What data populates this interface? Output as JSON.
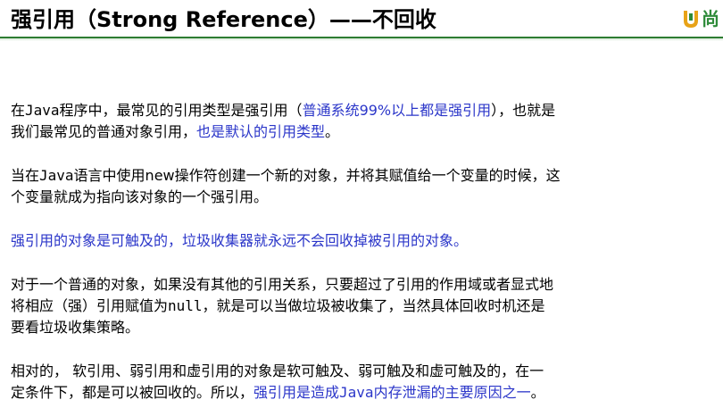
{
  "slide": {
    "title": "强引用（Strong Reference）——不回收",
    "logo_text": "尚",
    "colors": {
      "text": "#000000",
      "highlight": "#2b36c9",
      "rule": "#2e7d32",
      "logo": "#2e8b3a"
    }
  },
  "paragraphs": {
    "p1": {
      "l1_a": "在",
      "l1_code": "Java",
      "l1_b": "程序中，最常见的引用类型是强引用（",
      "l1_hl": "普通系统99%以上都是强引用",
      "l1_c": "），也就是",
      "l2_a": "我们最常见的普通对象引用，",
      "l2_hl": "也是默认的引用类型",
      "l2_b": "。"
    },
    "p2": {
      "l1_a": "当在",
      "l1_code": "Java",
      "l1_b": "语言中使用new操作符创建一个新的对象，并将其赋值给一个变量的时候，这",
      "l2": "个变量就成为指向该对象的一个强引用。"
    },
    "p3": {
      "l1_hl": "强引用的对象是可触及的，垃圾收集器就永远不会回收掉被引用的对象。"
    },
    "p4": {
      "l1": "对于一个普通的对象，如果没有其他的引用关系，只要超过了引用的作用域或者显式地",
      "l2_a": "将相应（强）引用赋值为",
      "l2_code": "null",
      "l2_b": "，就是可以当做垃圾被收集了，当然具体回收时机还是",
      "l3": "要看垃圾收集策略。"
    },
    "p5": {
      "l1": "相对的，  软引用、弱引用和虚引用的对象是软可触及、弱可触及和虚可触及的，在一",
      "l2_a": "定条件下，都是可以被回收的。所以，",
      "l2_hl_a": "强引用是造成",
      "l2_hl_code": "Java",
      "l2_hl_b": "内存泄漏的主要原因之一",
      "l2_b": "。"
    }
  }
}
